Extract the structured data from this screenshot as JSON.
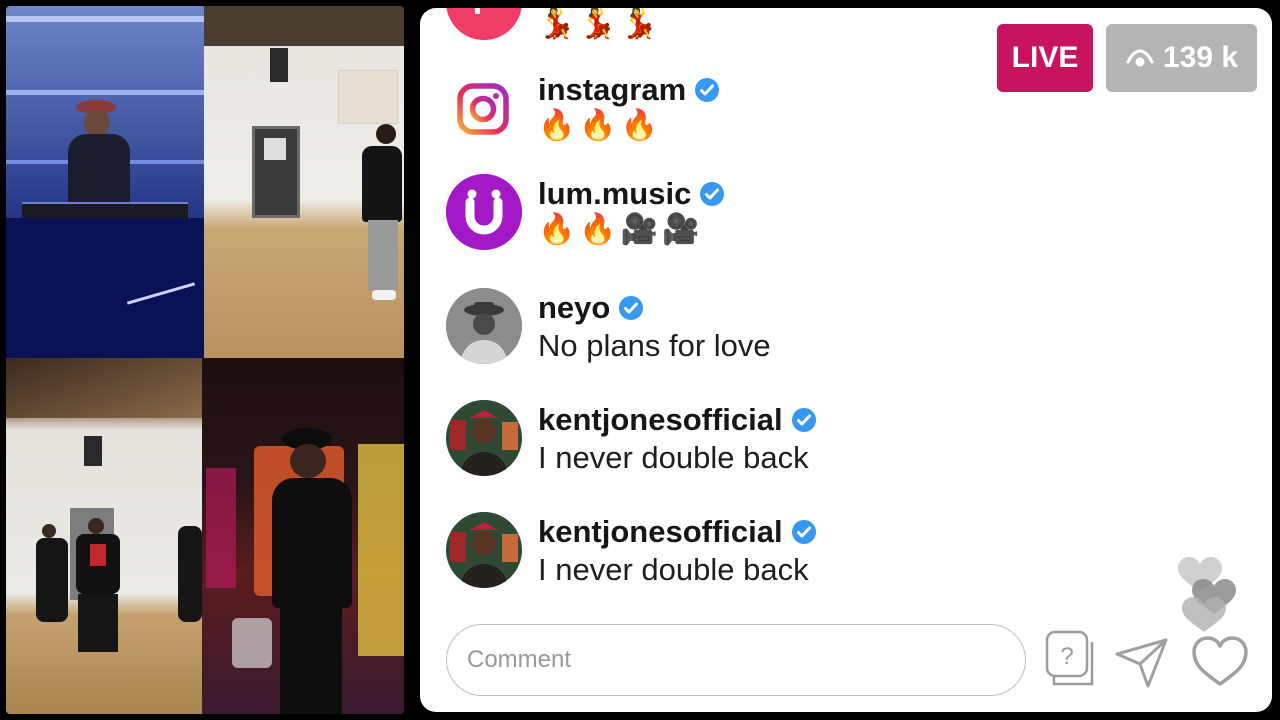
{
  "live": {
    "badge_label": "LIVE",
    "viewer_count": "139 k"
  },
  "comments": [
    {
      "username": "instagram",
      "verified": true,
      "emojis": "🔥🔥🔥"
    },
    {
      "username": "lum.music",
      "verified": true,
      "emojis": "🔥🔥🎥🎥"
    },
    {
      "username": "neyo",
      "verified": true,
      "text": "No plans for love"
    },
    {
      "username": "kentjonesofficial",
      "verified": true,
      "text": "I never double back"
    },
    {
      "username": "kentjonesofficial",
      "verified": true,
      "text": "I never double back"
    }
  ],
  "partial_comment": {
    "emojis": "💃💃💃"
  },
  "composer": {
    "placeholder": "Comment"
  },
  "icons": {
    "question": "question-icon",
    "send": "send-icon",
    "like": "heart-icon",
    "viewers": "eye-icon"
  },
  "colors": {
    "live_badge": "#c8145e",
    "viewer_badge": "#b5b5b5",
    "verified_blue": "#3897f0",
    "lum_purple": "#a319c8"
  }
}
